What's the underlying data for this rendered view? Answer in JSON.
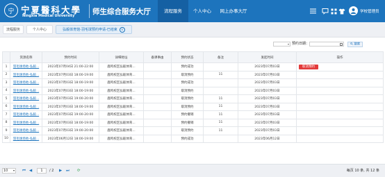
{
  "header": {
    "logo_mark": "宁",
    "logo_cn": "宁夏醫科大學",
    "logo_en": "Ningxia Medical University",
    "app_title": "师生综合服务大厅",
    "nav": [
      "流程服务",
      "个人中心",
      "网上办事大厅"
    ],
    "username": "学校管理员"
  },
  "page_tabs": [
    {
      "label": "流程服务"
    },
    {
      "label": "个人中心"
    },
    {
      "label": "弘毅体育馆-羽毛球预约申请-已结束"
    }
  ],
  "filter": {
    "select_value": "",
    "date_label": "预约日期：",
    "date_value": "",
    "search_label": "搜索"
  },
  "table": {
    "columns": [
      "",
      "资源名称",
      "预约时间",
      "详细地址",
      "备课事由",
      "预约状态",
      "备注",
      "发起时间",
      "操作"
    ],
    "rows": [
      {
        "idx": "1",
        "name": "羽毛球场地-弘毅...",
        "time": "2023年07月04日 21:00-22:00",
        "addr": "鹿鸣校区弘毅体育...",
        "reason": "",
        "status": "预约成功",
        "note": "",
        "created": "2023年07月03日",
        "action": "取消预约"
      },
      {
        "idx": "2",
        "name": "羽毛球场地-弘毅...",
        "time": "2023年07月03日 18:00-19:00",
        "addr": "鹿鸣校区弘毅体育...",
        "reason": "",
        "status": "取消预约",
        "note": "11",
        "created": "2023年07月03日",
        "action": ""
      },
      {
        "idx": "3",
        "name": "羽毛球场地-弘毅...",
        "time": "2023年07月03日 18:00-19:00",
        "addr": "鹿鸣校区弘毅体育...",
        "reason": "",
        "status": "预约成功",
        "note": "",
        "created": "2023年07月03日",
        "action": ""
      },
      {
        "idx": "4",
        "name": "羽毛球场地-弘毅...",
        "time": "2023年07月03日 18:00-19:00",
        "addr": "鹿鸣校区弘毅体育...",
        "reason": "",
        "status": "取消预约",
        "note": "",
        "created": "2023年07月03日",
        "action": ""
      },
      {
        "idx": "5",
        "name": "羽毛球场地-弘毅...",
        "time": "2023年07月03日 19:00-20:00",
        "addr": "鹿鸣校区弘毅体育...",
        "reason": "",
        "status": "取消预约",
        "note": "11",
        "created": "2023年07月03日",
        "action": ""
      },
      {
        "idx": "6",
        "name": "羽毛球场地-弘毅...",
        "time": "2023年07月03日 18:00-19:00",
        "addr": "鹿鸣校区弘毅体育...",
        "reason": "",
        "status": "取消预约",
        "note": "11",
        "created": "2023年07月03日",
        "action": ""
      },
      {
        "idx": "7",
        "name": "羽毛球场地-弘毅...",
        "time": "2023年07月03日 19:00-20:00",
        "addr": "鹿鸣校区弘毅体育...",
        "reason": "",
        "status": "预约撤销",
        "note": "11",
        "created": "2023年07月03日",
        "action": ""
      },
      {
        "idx": "8",
        "name": "羽毛球场地-弘毅...",
        "time": "2023年07月03日 18:00-19:00",
        "addr": "鹿鸣校区弘毅体育...",
        "reason": "",
        "status": "预约撤销",
        "note": "11",
        "created": "2023年07月03日",
        "action": ""
      },
      {
        "idx": "9",
        "name": "羽毛球场地-弘毅...",
        "time": "2023年07月03日 19:00-20:00",
        "addr": "鹿鸣校区弘毅体育...",
        "reason": "",
        "status": "取消预约",
        "note": "11",
        "created": "2023年07月03日",
        "action": ""
      },
      {
        "idx": "10",
        "name": "羽毛球场地-弘毅...",
        "time": "2023年06月12日 18:00-19:00",
        "addr": "鹿鸣校区弘毅体育...",
        "reason": "",
        "status": "预约成功",
        "note": "",
        "created": "2023年06月12日",
        "action": ""
      }
    ]
  },
  "pager": {
    "page_size": "10",
    "current_page": "1",
    "total_pages": "/ 2",
    "info": "每页 10 条, 共 12 条"
  },
  "colors": {
    "brand": "#1d74bd",
    "brand_dark": "#1560a3",
    "danger": "#e33b3b",
    "refresh": "#3aa655"
  },
  "icons": {
    "header": [
      "menu-icon",
      "message-icon",
      "grid-icon",
      "shirt-icon",
      "avatar"
    ],
    "filter": [
      "dropdown-arrow-icon",
      "calendar-icon",
      "search-icon"
    ],
    "pager": [
      "first-page-icon",
      "prev-page-icon",
      "next-page-icon",
      "last-page-icon",
      "refresh-icon"
    ]
  }
}
